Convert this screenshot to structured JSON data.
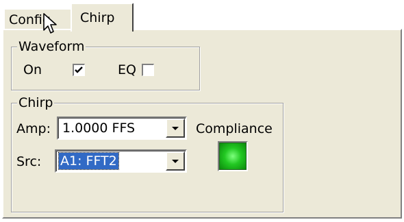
{
  "tabs": [
    {
      "label": "Config."
    },
    {
      "label": "Chirp",
      "active": true
    }
  ],
  "waveform": {
    "group_label": "Waveform",
    "on_label": "On",
    "on_checked": true,
    "eq_label": "EQ",
    "eq_checked": false
  },
  "chirp": {
    "group_label": "Chirp",
    "amp_label": "Amp:",
    "amp_value": "1.0000 FFS",
    "src_label": "Src:",
    "src_value": "A1: FFT2",
    "compliance_label": "Compliance",
    "compliance_led_color": "#22c822"
  },
  "icons": {
    "check": "check-icon",
    "dropdown": "chevron-down-icon",
    "cursor": "mouse-pointer-icon"
  }
}
